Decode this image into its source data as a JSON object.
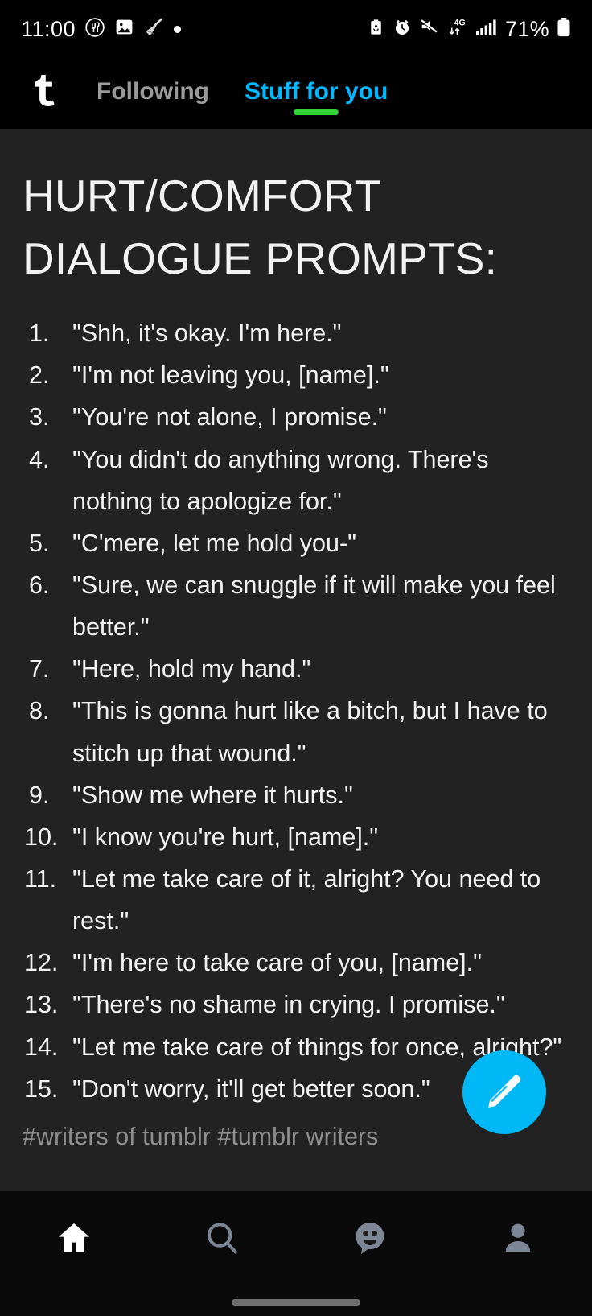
{
  "status_bar": {
    "time": "11:00",
    "battery_percent": "71%",
    "network_type": "4G",
    "left_icons": [
      "food-delivery-icon",
      "photo-icon",
      "broom-cleaner-icon",
      "dot-indicator-icon"
    ],
    "right_icons": [
      "battery-saver-icon",
      "alarm-clock-icon",
      "mute-icon",
      "mobile-data-icon",
      "signal-bars-icon",
      "battery-icon"
    ]
  },
  "top_nav": {
    "logo": "tumblr-t-logo",
    "tabs": [
      {
        "label": "Following",
        "active": false
      },
      {
        "label": "Stuff for you",
        "active": true
      }
    ],
    "active_tab_indicator_color": "#35d13b",
    "active_tab_text_color": "#00b8ff",
    "inactive_tab_text_color": "#9a9a9a"
  },
  "post": {
    "title": "HURT/COMFORT\nDIALOGUE PROMPTS:",
    "prompts": [
      {
        "number": "1.",
        "text": "\"Shh, it's okay. I'm here.\""
      },
      {
        "number": "2.",
        "text": "\"I'm not leaving you, [name].\""
      },
      {
        "number": "3.",
        "text": "\"You're not alone, I promise.\""
      },
      {
        "number": "4.",
        "text": "\"You didn't do anything wrong. There's nothing to apologize for.\""
      },
      {
        "number": "5.",
        "text": "\"C'mere, let me hold you-\""
      },
      {
        "number": "6.",
        "text": "\"Sure, we can snuggle if it will make you feel better.\""
      },
      {
        "number": "7.",
        "text": "\"Here, hold my hand.\""
      },
      {
        "number": "8.",
        "text": "\"This is gonna hurt like a bitch, but I have to stitch up that wound.\""
      },
      {
        "number": "9.",
        "text": "\"Show me where it hurts.\""
      },
      {
        "number": "10.",
        "text": "\"I know you're hurt, [name].\""
      },
      {
        "number": "11.",
        "text": "\"Let me take care of it, alright? You need to rest.\""
      },
      {
        "number": "12.",
        "text": "\"I'm here to take care of you, [name].\""
      },
      {
        "number": "13.",
        "text": "\"There's no shame in crying. I promise.\""
      },
      {
        "number": "14.",
        "text": "\"Let me take care of things for once, alright?\""
      },
      {
        "number": "15.",
        "text": "\"Don't worry, it'll get better soon.\""
      }
    ],
    "tags": "#writers of tumblr #tumblr writers",
    "background_color": "#222222",
    "text_color": "#f2f2f2",
    "tag_color": "#8e8e8e"
  },
  "compose_fab": {
    "icon": "pencil-icon",
    "background_color": "#00b8f5"
  },
  "bottom_nav": {
    "items": [
      {
        "name": "home",
        "icon": "home-icon",
        "active": true
      },
      {
        "name": "explore",
        "icon": "search-icon",
        "active": false
      },
      {
        "name": "messages",
        "icon": "chat-smiley-icon",
        "active": false
      },
      {
        "name": "account",
        "icon": "person-icon",
        "active": false
      }
    ],
    "active_color": "#ffffff",
    "inactive_color": "#7d8694"
  }
}
